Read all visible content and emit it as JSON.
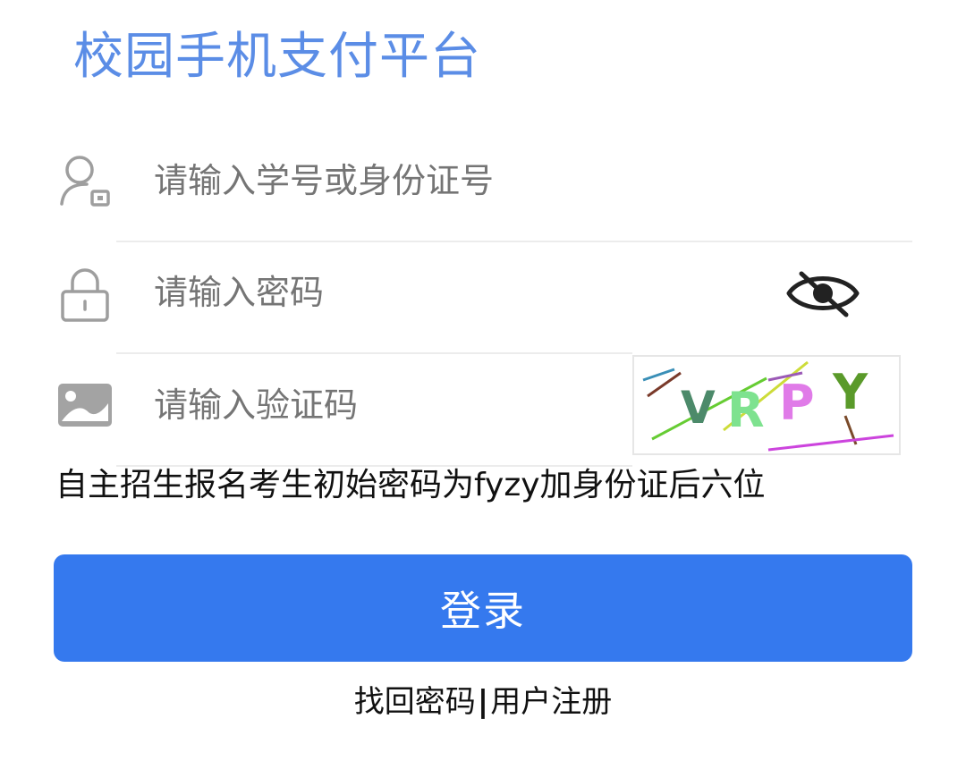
{
  "app": {
    "title": "校园手机支付平台"
  },
  "form": {
    "username_placeholder": "请输入学号或身份证号",
    "username_value": "",
    "password_placeholder": "请输入密码",
    "password_value": "",
    "captcha_placeholder": "请输入验证码",
    "captcha_value": "",
    "captcha_text": "VRPY"
  },
  "notice": "自主招生报名考生初始密码为fyzy加身份证后六位",
  "login_button": "登录",
  "links": {
    "recover": "找回密码",
    "separator": "|",
    "register": "用户注册"
  },
  "icons": {
    "user": "user-icon",
    "lock": "lock-icon",
    "image": "image-icon",
    "eye": "eye-off-icon"
  },
  "colors": {
    "title": "#5b8de6",
    "primary_button": "#3579ee",
    "icon": "#9e9e9e"
  }
}
